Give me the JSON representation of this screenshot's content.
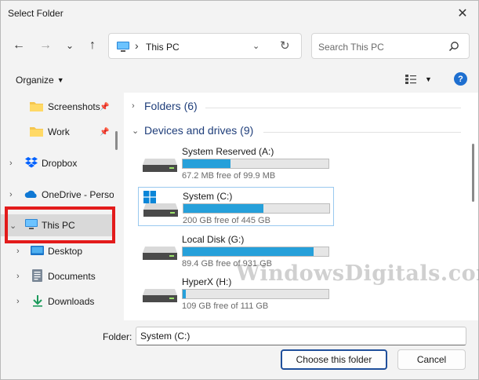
{
  "window": {
    "title": "Select Folder",
    "close_glyph": "✕"
  },
  "nav": {
    "back_glyph": "←",
    "forward_glyph": "→",
    "recent_glyph": "⌄",
    "up_glyph": "↑",
    "address": {
      "separator": "›",
      "text": "This PC",
      "dropdown_glyph": "⌄",
      "refresh_glyph": "↻"
    },
    "search": {
      "placeholder": "Search This PC"
    }
  },
  "toolbar": {
    "organize_label": "Organize",
    "caret": "▼",
    "view_caret": "▼",
    "help_label": "?"
  },
  "sidebar": {
    "items": [
      {
        "label": "Screenshots",
        "pinned": true,
        "pin_glyph": "📌"
      },
      {
        "label": "Work",
        "pinned": true,
        "pin_glyph": "📌"
      },
      {
        "label": "Dropbox",
        "chevron": "›"
      },
      {
        "label": "OneDrive - Perso",
        "chevron": "›"
      },
      {
        "label": "This PC",
        "chevron": "⌄"
      },
      {
        "label": "Desktop",
        "chevron": "›"
      },
      {
        "label": "Documents",
        "chevron": "›"
      },
      {
        "label": "Downloads",
        "chevron": "›"
      }
    ]
  },
  "main": {
    "folders_group": {
      "label": "Folders (6)",
      "chevron": "›"
    },
    "drives_group": {
      "label": "Devices and drives (9)",
      "chevron": "⌄"
    },
    "drives": [
      {
        "name": "System Reserved (A:)",
        "free_text": "67.2 MB free of 99.9 MB",
        "used_fraction": 0.33
      },
      {
        "name": "System (C:)",
        "free_text": "200 GB free of 445 GB",
        "used_fraction": 0.55
      },
      {
        "name": "Local Disk (G:)",
        "free_text": "89.4 GB free of 931 GB",
        "used_fraction": 0.9
      },
      {
        "name": "HyperX (H:)",
        "free_text": "109 GB free of 111 GB",
        "used_fraction": 0.02
      }
    ]
  },
  "watermark": {
    "text": "WindowsDigitals.com"
  },
  "footer": {
    "folder_label": "Folder:",
    "folder_value": "System (C:)",
    "choose_label": "Choose this folder",
    "cancel_label": "Cancel"
  },
  "colors": {
    "accent": "#26a0da",
    "highlight_box": "#e31b1b",
    "group_header": "#1f3e7a"
  }
}
